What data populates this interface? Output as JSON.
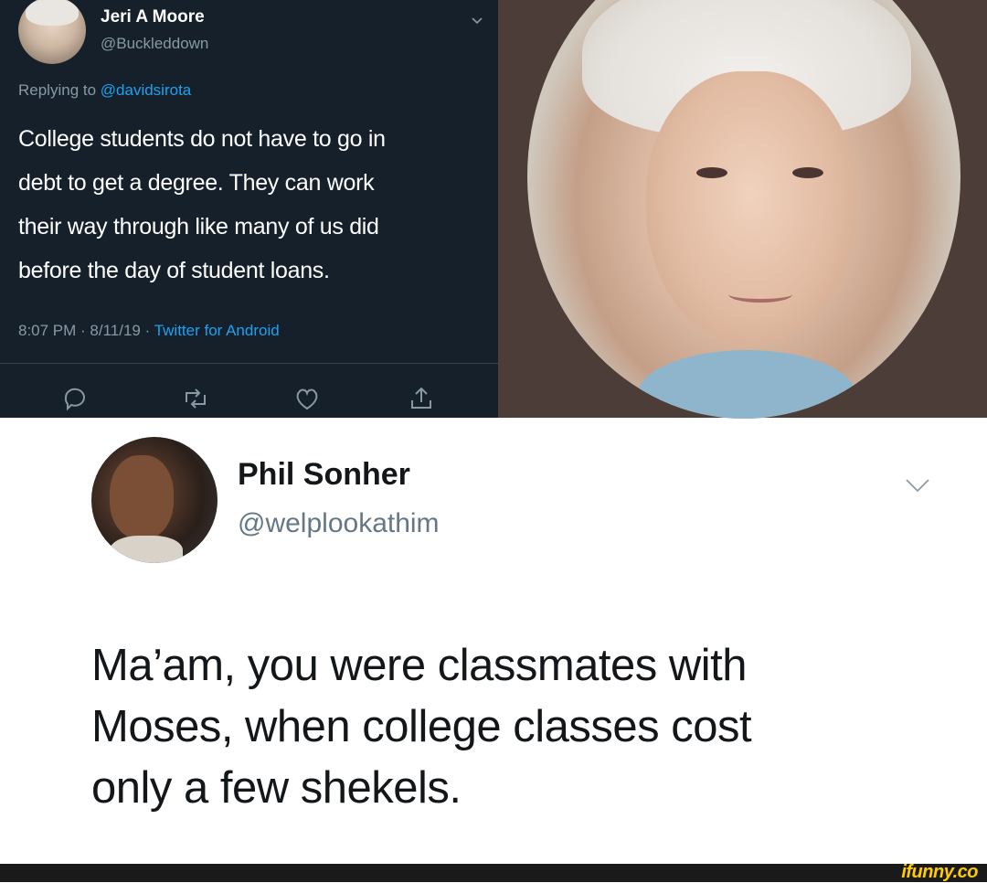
{
  "tweet1": {
    "name": "Jeri A Moore",
    "handle": "@Buckleddown",
    "replying_prefix": "Replying to ",
    "replying_to": "@davidsirota",
    "text_lines": [
      "College students do not have to go in",
      "debt to get a degree. They can work",
      "their way through like many of us did",
      "before the day of student loans."
    ],
    "timestamp": "8:07 PM · 8/11/19 · ",
    "source": "Twitter for Android"
  },
  "tweet2": {
    "name": "Phil Sonher",
    "handle": "@welplookathim",
    "text_lines": [
      "Ma’am, you were classmates with",
      "Moses, when college classes cost",
      "only a few shekels."
    ]
  },
  "watermark": "ifunny.co",
  "icons": [
    "avatar-jeri",
    "chevron-down-icon",
    "reply-icon",
    "retweet-icon",
    "like-icon",
    "share-icon",
    "avatar-phil",
    "chevron-down-icon"
  ],
  "colors": {
    "dark_bg": "#15202b",
    "link_blue": "#1da1f2",
    "muted_gray": "#8899a6",
    "photo_panel": "#4d3d38",
    "watermark_yellow": "#ffcc00"
  }
}
